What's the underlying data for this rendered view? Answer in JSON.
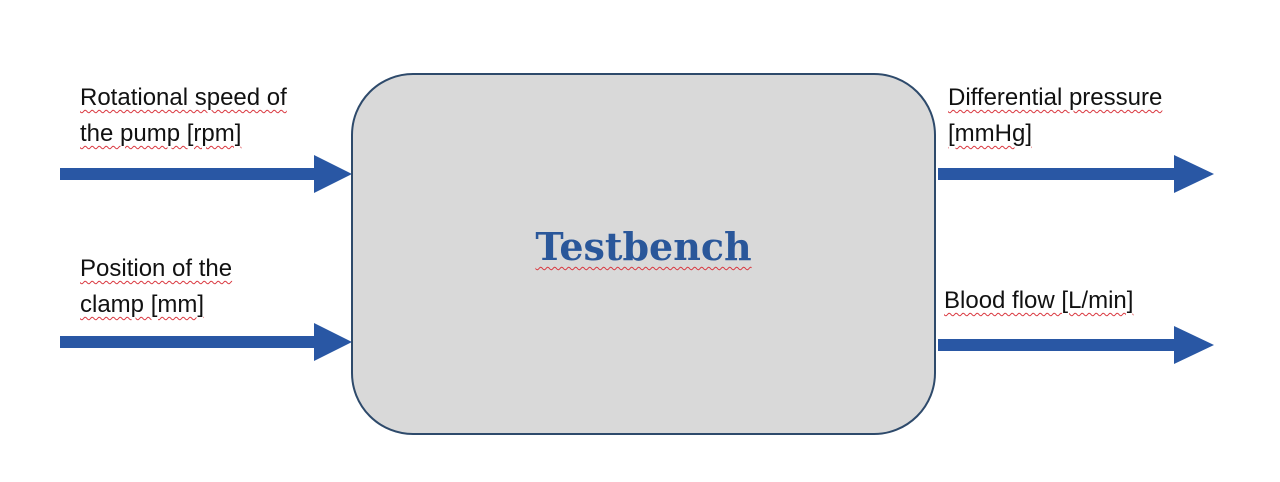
{
  "block": {
    "title": "Testbench",
    "fill_color": "#d9d9d9",
    "border_color": "#2e4a6b",
    "title_color": "#2a579a"
  },
  "inputs": [
    {
      "line1": "Rotational speed of",
      "line2": "the pump [rpm]"
    },
    {
      "line1": "Position of the",
      "line2": "clamp [mm]"
    }
  ],
  "outputs": [
    {
      "line1": "Differential pressure",
      "line2": "[mmHg]"
    },
    {
      "line1": "Blood flow [L/min]"
    }
  ],
  "arrow_color": "#2957a4"
}
